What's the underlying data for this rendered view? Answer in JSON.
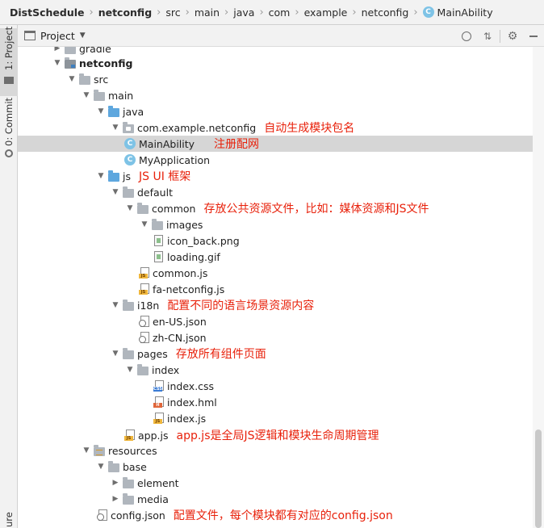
{
  "breadcrumb": [
    "DistSchedule",
    "netconfig",
    "src",
    "main",
    "java",
    "com",
    "example",
    "netconfig",
    "MainAbility"
  ],
  "class_letter": "C",
  "sidebar": {
    "project_tab": "1: Project",
    "commit_tab": "0: Commit",
    "bottom_tab": "ure"
  },
  "panel": {
    "title": "Project"
  },
  "tree": [
    {
      "label": "gradle",
      "icon": "folder"
    },
    {
      "label": "netconfig",
      "icon": "module-folder"
    },
    {
      "label": "src",
      "icon": "folder"
    },
    {
      "label": "main",
      "icon": "folder"
    },
    {
      "label": "java",
      "icon": "source-folder"
    },
    {
      "label": "com.example.netconfig",
      "icon": "package-folder",
      "note": "自动生成模块包名"
    },
    {
      "label": "MainAbility",
      "icon": "class",
      "note": "注册配网",
      "selected": true
    },
    {
      "label": "MyApplication",
      "icon": "class"
    },
    {
      "label": "js",
      "icon": "source-folder",
      "note": "JS UI 框架"
    },
    {
      "label": "default",
      "icon": "folder"
    },
    {
      "label": "common",
      "icon": "folder",
      "note": "存放公共资源文件，比如：媒体资源和JS文件"
    },
    {
      "label": "images",
      "icon": "folder"
    },
    {
      "label": "icon_back.png",
      "icon": "image-file"
    },
    {
      "label": "loading.gif",
      "icon": "image-file"
    },
    {
      "label": "common.js",
      "icon": "js-file"
    },
    {
      "label": "fa-netconfig.js",
      "icon": "js-file"
    },
    {
      "label": "i18n",
      "icon": "folder",
      "note": "配置不同的语言场景资源内容"
    },
    {
      "label": "en-US.json",
      "icon": "json-file"
    },
    {
      "label": "zh-CN.json",
      "icon": "json-file"
    },
    {
      "label": "pages",
      "icon": "folder",
      "note": "存放所有组件页面"
    },
    {
      "label": "index",
      "icon": "folder"
    },
    {
      "label": "index.css",
      "icon": "css-file"
    },
    {
      "label": "index.hml",
      "icon": "hml-file"
    },
    {
      "label": "index.js",
      "icon": "js-file"
    },
    {
      "label": "app.js",
      "icon": "js-file",
      "note": "app.js是全局JS逻辑和模块生命周期管理"
    },
    {
      "label": "resources",
      "icon": "resources-folder"
    },
    {
      "label": "base",
      "icon": "folder"
    },
    {
      "label": "element",
      "icon": "folder"
    },
    {
      "label": "media",
      "icon": "folder"
    },
    {
      "label": "config.json",
      "icon": "json-file",
      "note": "配置文件，每个模块都有对应的config.json"
    }
  ]
}
